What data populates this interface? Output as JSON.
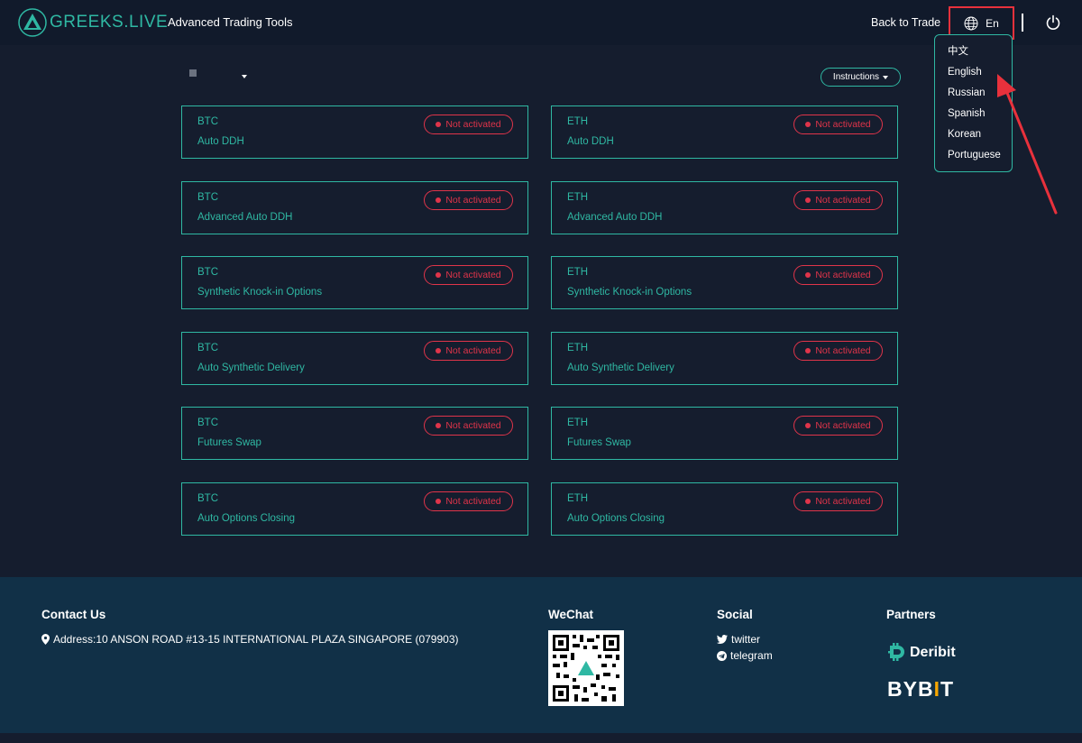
{
  "header": {
    "brand": "GREEKS.LIVE",
    "app_title": "Advanced Trading Tools",
    "back_to_trade": "Back to Trade",
    "language": "En"
  },
  "language_menu": [
    "中文",
    "English",
    "Russian",
    "Spanish",
    "Korean",
    "Portuguese"
  ],
  "toolbar": {
    "instructions": "Instructions"
  },
  "status_label": "Not activated",
  "cards": [
    {
      "coin": "BTC",
      "tool": "Auto DDH"
    },
    {
      "coin": "ETH",
      "tool": "Auto DDH"
    },
    {
      "coin": "BTC",
      "tool": "Advanced Auto DDH"
    },
    {
      "coin": "ETH",
      "tool": "Advanced Auto DDH"
    },
    {
      "coin": "BTC",
      "tool": "Synthetic Knock-in Options"
    },
    {
      "coin": "ETH",
      "tool": "Synthetic Knock-in Options"
    },
    {
      "coin": "BTC",
      "tool": "Auto Synthetic Delivery"
    },
    {
      "coin": "ETH",
      "tool": "Auto Synthetic Delivery"
    },
    {
      "coin": "BTC",
      "tool": "Futures Swap"
    },
    {
      "coin": "ETH",
      "tool": "Futures Swap"
    },
    {
      "coin": "BTC",
      "tool": "Auto Options Closing"
    },
    {
      "coin": "ETH",
      "tool": "Auto Options Closing"
    }
  ],
  "footer": {
    "contact_heading": "Contact Us",
    "address": "Address:10 ANSON ROAD #13-15 INTERNATIONAL PLAZA SINGAPORE (079903)",
    "wechat_heading": "WeChat",
    "social_heading": "Social",
    "twitter": "twitter",
    "telegram": "telegram",
    "partners_heading": "Partners",
    "deribit": "Deribit",
    "bybit_pre": "BYB",
    "bybit_i": "I",
    "bybit_post": "T"
  },
  "colors": {
    "accent": "#2fb8a3",
    "danger": "#e0344a",
    "background": "#151d2e",
    "footer": "#113047",
    "annotation": "#e8313c"
  },
  "icons": [
    "logo-icon",
    "globe-icon",
    "power-icon",
    "caret-down-icon",
    "map-pin-icon",
    "twitter-icon",
    "telegram-icon",
    "deribit-logo",
    "wechat-qr-code",
    "annotation-arrow"
  ]
}
